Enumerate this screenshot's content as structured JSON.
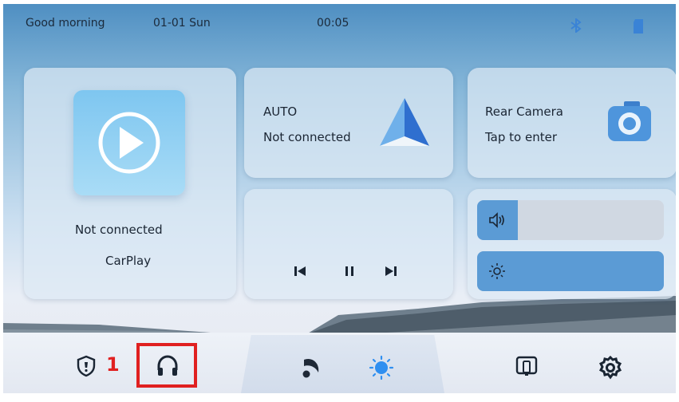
{
  "status_bar": {
    "greeting": "Good morning",
    "date": "01-01 Sun",
    "time": "00:05"
  },
  "carplay": {
    "status": "Not connected",
    "label": "CarPlay"
  },
  "android_auto": {
    "title": "AUTO",
    "status": "Not connected"
  },
  "rear_camera": {
    "title": "Rear Camera",
    "subtitle": "Tap to enter"
  },
  "sliders": {
    "volume_level": 0.22,
    "brightness_level": 1.0
  },
  "dock": {
    "badge_number": "1"
  },
  "colors": {
    "accent": "#5b9bd5",
    "highlight_box": "#e02020",
    "badge": "#e02020"
  },
  "icons": [
    "bluetooth-icon",
    "sd-card-icon",
    "carplay-play-icon",
    "android-auto-icon",
    "camera-icon",
    "prev-icon",
    "pause-icon",
    "next-icon",
    "volume-icon",
    "brightness-icon",
    "shield-icon",
    "headphones-icon",
    "night-mode-icon",
    "day-mode-icon",
    "screen-mirror-icon",
    "settings-icon"
  ]
}
